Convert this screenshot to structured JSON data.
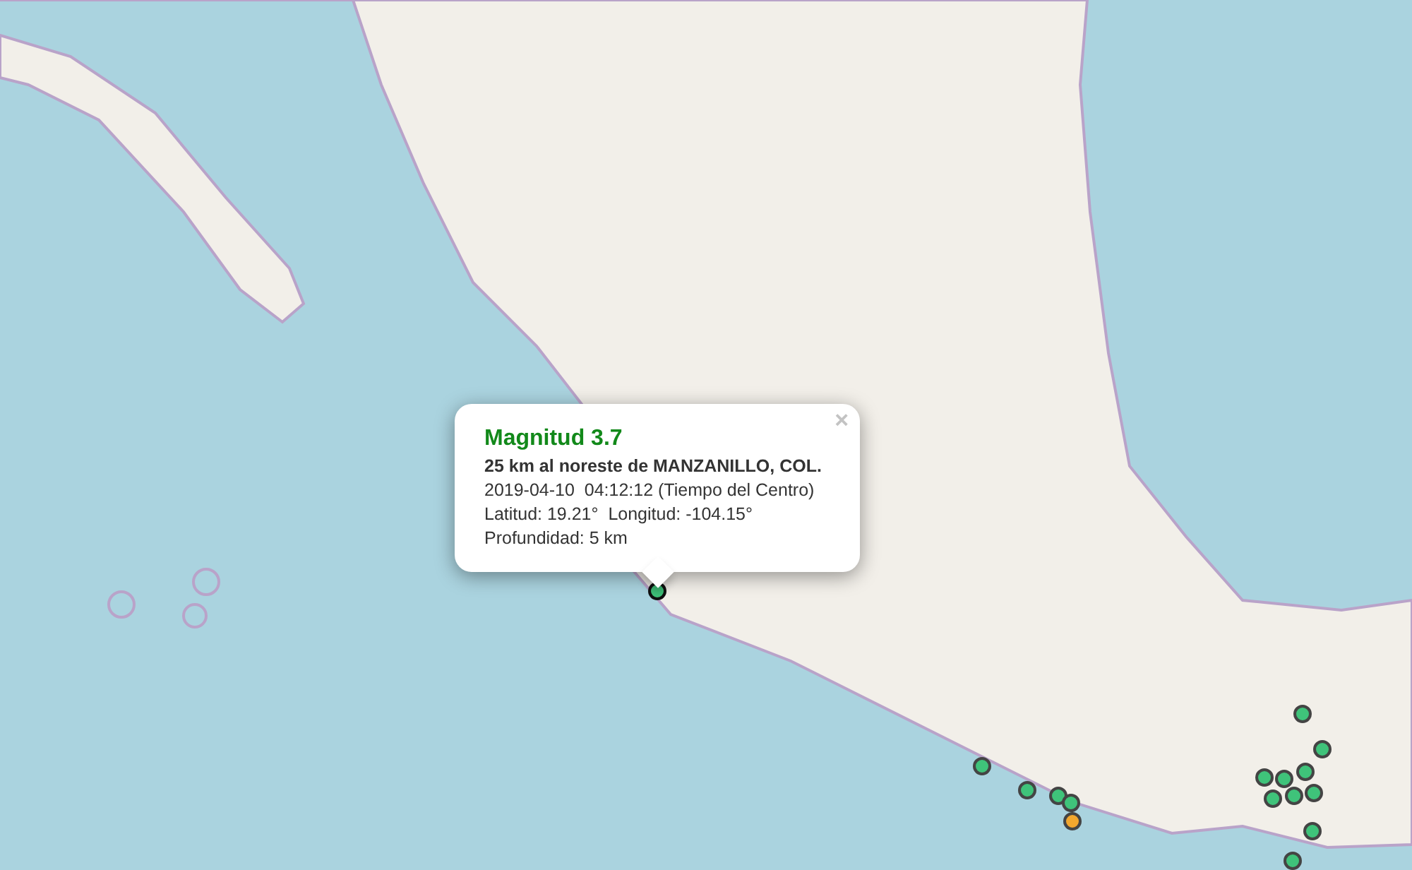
{
  "popup": {
    "close": "×",
    "title": "Magnitud 3.7",
    "place": "25 km al noreste de MANZANILLO, COL.",
    "datetime": "2019-04-10  04:12:12 (Tiempo del Centro)",
    "coordinates": "Latitud: 19.21°  Longitud: -104.15°",
    "depth": "Profundidad: 5 km"
  },
  "markers": [
    {
      "color": "#3fc37a",
      "selected": true
    },
    {
      "color": "#3fc37a",
      "selected": false
    },
    {
      "color": "#3fc37a",
      "selected": false
    },
    {
      "color": "#3fc37a",
      "selected": false
    },
    {
      "color": "#3fc37a",
      "selected": false
    },
    {
      "color": "#f2a72e",
      "selected": false
    },
    {
      "color": "#3fc37a",
      "selected": false
    },
    {
      "color": "#3fc37a",
      "selected": false
    },
    {
      "color": "#3fc37a",
      "selected": false
    },
    {
      "color": "#3fc37a",
      "selected": false
    },
    {
      "color": "#3fc37a",
      "selected": false
    },
    {
      "color": "#3fc37a",
      "selected": false
    },
    {
      "color": "#3fc37a",
      "selected": false
    },
    {
      "color": "#3fc37a",
      "selected": false
    },
    {
      "color": "#3fc37a",
      "selected": false
    },
    {
      "color": "#3fc37a",
      "selected": false
    }
  ]
}
